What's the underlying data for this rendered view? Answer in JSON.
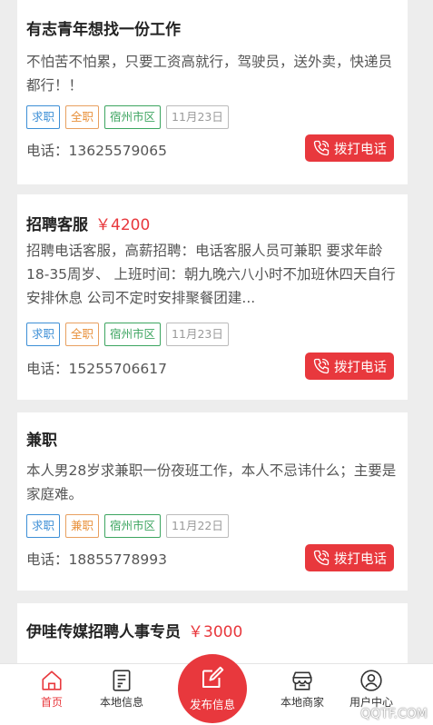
{
  "listings": [
    {
      "title": "有志青年想找一份工作",
      "salary": "",
      "description": "不怕苦不怕累，只要工资高就行，驾驶员，送外卖，快递员都行！！",
      "tags": [
        "求职",
        "全职",
        "宿州市区",
        "11月23日"
      ],
      "phone": "电话：13625579065",
      "call_label": "拨打电话"
    },
    {
      "title": "招聘客服",
      "salary": "￥4200",
      "description": "招聘电话客服，高薪招聘：电话客服人员可兼职 要求年龄18-35周岁、 上班时间：朝九晚六八小时不加班休四天自行安排休息 公司不定时安排聚餐团建...",
      "tags": [
        "求职",
        "全职",
        "宿州市区",
        "11月23日"
      ],
      "phone": "电话：15255706617",
      "call_label": "拨打电话"
    },
    {
      "title": "兼职",
      "salary": "",
      "description": "本人男28岁求兼职一份夜班工作，本人不忌讳什么；主要是家庭难。",
      "tags": [
        "求职",
        "兼职",
        "宿州市区",
        "11月22日"
      ],
      "phone": "电话：18855778993",
      "call_label": "拨打电话"
    },
    {
      "title": "伊哇传媒招聘人事专员",
      "salary": "￥3000"
    }
  ],
  "tabbar": {
    "home": "首页",
    "local_info": "本地信息",
    "publish": "发布信息",
    "local_merchants": "本地商家",
    "user_center": "用户中心"
  },
  "watermark": "QQTF.COM",
  "colors": {
    "accent": "#e8383d",
    "tag_type": "#3d8fd6",
    "tag_kind": "#e8903a",
    "tag_area": "#3da560",
    "tag_date": "#9a9a9a"
  }
}
